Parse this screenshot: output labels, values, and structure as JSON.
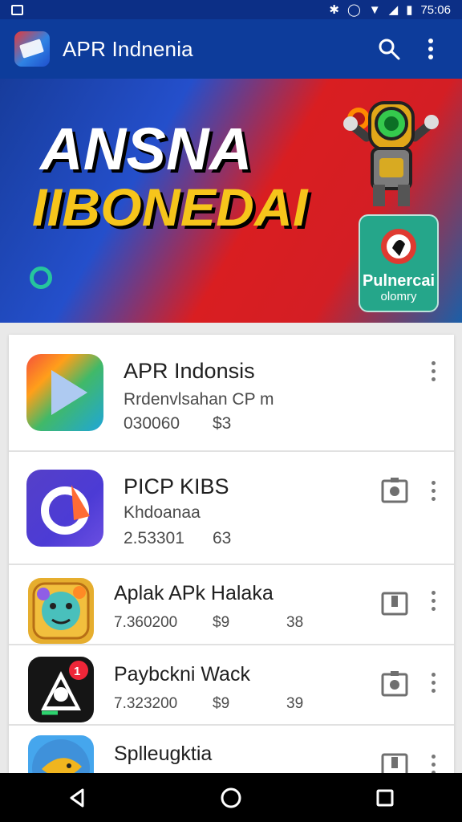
{
  "status_bar": {
    "time": "75:06"
  },
  "header": {
    "title": "APR Indnenia"
  },
  "banner": {
    "line1": "ANSNA",
    "line2": "IIBONEDAI",
    "card_title": "Pulnercai",
    "card_subtitle": "olomry"
  },
  "apps": [
    {
      "name": "APR Indonsis",
      "subtitle": "Rrdenvlsahan CP  m",
      "meta_left": "030060",
      "meta_right": "$3"
    },
    {
      "name": "PICP KIBS",
      "subtitle": "Khdoanaa",
      "meta_left": "2.53301",
      "meta_right": "63"
    },
    {
      "name": "Aplak APk Halaka",
      "meta_left": "7.360200",
      "meta_middle": "$9",
      "meta_right": "38"
    },
    {
      "name": "Paybckni Wack",
      "meta_left": "7.323200",
      "meta_middle": "$9",
      "meta_right": "39"
    },
    {
      "name": "Splleugktia"
    }
  ],
  "icons": {
    "search": "search-icon",
    "more": "more-vert-icon",
    "back": "back-icon",
    "home": "home-icon",
    "recent": "recent-apps-icon"
  },
  "colors": {
    "app_bar": "#0d3c9b",
    "banner_blue": "#244fcb",
    "banner_red": "#d91e21",
    "banner_yellow": "#f6c51b",
    "accent_green": "#26c59d"
  }
}
